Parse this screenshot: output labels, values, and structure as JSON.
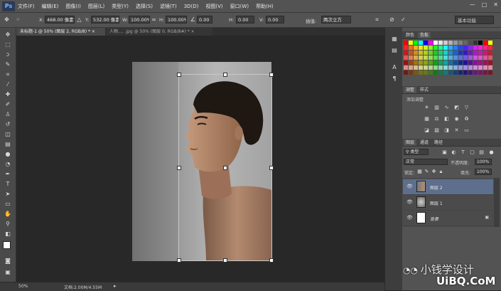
{
  "app": {
    "logo": "Ps"
  },
  "menu": [
    "文件(F)",
    "编辑(E)",
    "图像(I)",
    "图层(L)",
    "类型(Y)",
    "选择(S)",
    "滤镜(T)",
    "3D(D)",
    "视图(V)",
    "窗口(W)",
    "帮助(H)"
  ],
  "window_controls": [
    "—",
    "□",
    "✕"
  ],
  "options": {
    "x_label": "X:",
    "x_value": "468.00 像素",
    "y_label": "Y:",
    "y_value": "532.00 像素",
    "w_label": "W:",
    "w_value": "100.00%",
    "h_label": "H:",
    "h_value": "100.00%",
    "angle_value": "0.00",
    "hskew_label": "H:",
    "hskew_value": "0.00",
    "vskew_label": "V:",
    "vskew_value": "0.00",
    "interp_label": "插值:",
    "interp_value": "两次立方",
    "workspace": "基本功能"
  },
  "tabs": [
    {
      "label": "未标题-1 @ 50% (图层 2, RGB/8) *",
      "close": "×"
    },
    {
      "label": "人物.... .jpg @ 50% (图层 0, RGB/8#) *",
      "close": "×"
    }
  ],
  "status": {
    "zoom": "50%",
    "doc": "文档:2.00M/4.55M"
  },
  "panels": {
    "color_tabs": [
      "颜色",
      "色板"
    ],
    "adjust_tabs": [
      "调整",
      "样式"
    ],
    "adjust_title": "添加调整",
    "layers_tabs": [
      "图层",
      "通道",
      "路径"
    ],
    "filter_kind": "类型",
    "blend_mode": "正常",
    "opacity_label": "不透明度:",
    "opacity_value": "100%",
    "lock_label": "锁定:",
    "fill_label": "填充:",
    "fill_value": "100%",
    "layers": [
      {
        "name": "图层 2",
        "selected": true
      },
      {
        "name": "图层 1",
        "selected": false
      },
      {
        "name": "背景",
        "selected": false
      }
    ]
  },
  "watermark": {
    "line1": "小钱学设计",
    "line2": "UiBQ.CoM"
  },
  "colors": {
    "accent": "#5a7fa8",
    "selected_layer": "#5d6f8c"
  }
}
